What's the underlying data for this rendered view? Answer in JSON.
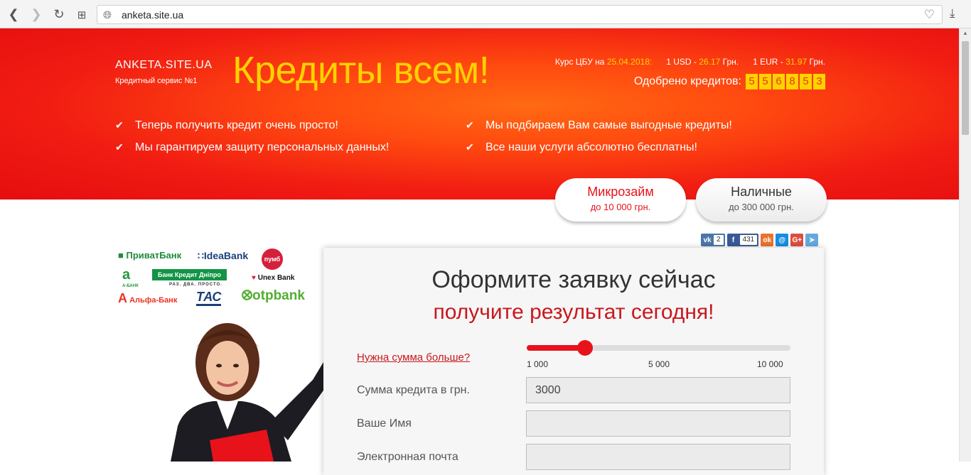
{
  "browser": {
    "url": "anketa.site.ua"
  },
  "brand": {
    "name": "ANKETA.SITE.UA",
    "subtitle": "Кредитный сервис №1",
    "headline": "Кредиты всем!"
  },
  "rates": {
    "prefix": "Курс ЦБУ на",
    "date": "25.04.2018:",
    "usd_label": "1 USD -",
    "usd_value": "26.17",
    "eur_label": "1 EUR -",
    "eur_value": "31.97",
    "currency": "Грн."
  },
  "approved": {
    "label": "Одобрено кредитов:",
    "digits": [
      "5",
      "5",
      "6",
      "8",
      "5",
      "3"
    ]
  },
  "features": [
    "Теперь получить кредит очень просто!",
    "Мы гарантируем защиту персональных данных!",
    "Мы подбираем Вам самые выгодные кредиты!",
    "Все наши услуги абсолютно бесплатны!"
  ],
  "tabs": [
    {
      "title": "Микрозайм",
      "subtitle": "до 10 000 грн."
    },
    {
      "title": "Наличные",
      "subtitle": "до 300 000 грн."
    }
  ],
  "share": {
    "vk_count": "2",
    "fb_count": "431"
  },
  "banks": {
    "privat": "ПриватБанк",
    "idea": "IdeaBank",
    "pumb": "пумб",
    "a_bank": "А-БАНК",
    "kredit_dnipro": "Банк Кредит Дніпро",
    "kredit_dnipro_sub": "РАЗ. ДВА. ПРОСТО.",
    "unex": "Unex Bank",
    "alfa": "Альфа-Банк",
    "tas": "ТАС",
    "otp": "otpbank"
  },
  "form": {
    "title": "Оформите заявку сейчас",
    "subtitle": "получите результат сегодня!",
    "more_link": "Нужна сумма больше?",
    "slider_value": 3000,
    "slider_min": 1000,
    "slider_max": 10000,
    "ticks": [
      "1 000",
      "5 000",
      "10 000"
    ],
    "amount_label": "Сумма кредита в грн.",
    "amount_value": "3000",
    "name_label": "Ваше Имя",
    "name_value": "",
    "email_label": "Электронная почта",
    "email_value": ""
  },
  "colors": {
    "accent_red": "#e8121b",
    "accent_yellow": "#ffd200"
  }
}
